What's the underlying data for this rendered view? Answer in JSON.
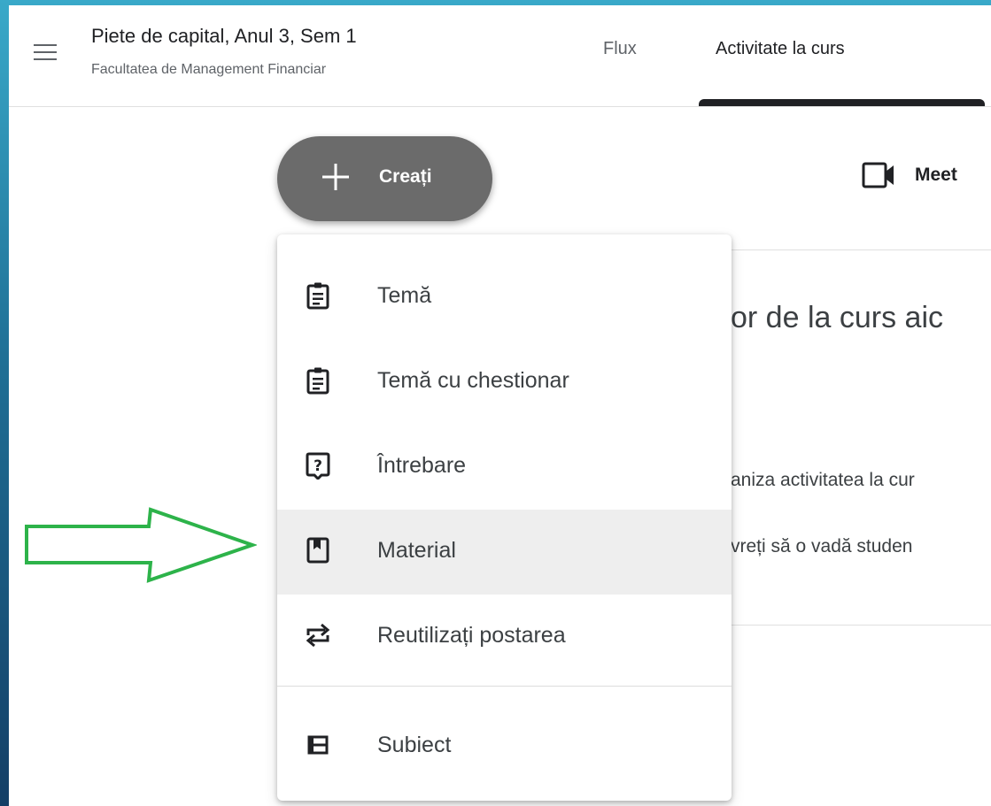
{
  "header": {
    "course_title": "Piete de capital, Anul 3, Sem 1",
    "course_subtitle": "Facultatea de Management Financiar",
    "tabs": [
      {
        "label": "Flux"
      },
      {
        "label": "Activitate la curs",
        "active": true
      }
    ]
  },
  "toolbar": {
    "create_label": "Creați",
    "meet_label": "Meet"
  },
  "background_content": {
    "heading": "or de la curs aic",
    "line1": "aniza activitatea la cur",
    "line2": "vreți să o vadă studen"
  },
  "create_menu": {
    "items": [
      {
        "label": "Temă",
        "icon": "assignment-icon"
      },
      {
        "label": "Temă cu chestionar",
        "icon": "quiz-assignment-icon"
      },
      {
        "label": "Întrebare",
        "icon": "question-icon"
      },
      {
        "label": "Material",
        "icon": "material-icon",
        "highlighted": true
      },
      {
        "label": "Reutilizați postarea",
        "icon": "repost-icon"
      },
      {
        "label": "Subiect",
        "icon": "topic-icon"
      }
    ]
  },
  "annotation": {
    "color": "#2db34a",
    "icon": "right-arrow-annotation"
  }
}
